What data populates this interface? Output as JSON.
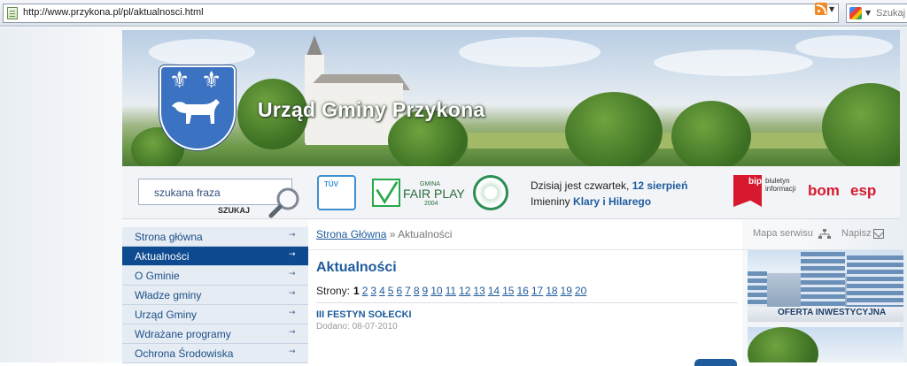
{
  "browser": {
    "url": "http://www.przykona.pl/pl/aktualnosci.html",
    "search_engine_label": "Szukaj"
  },
  "header": {
    "site_title": "Urząd Gminy Przykona"
  },
  "search": {
    "placeholder": "szukana fraza",
    "button_label": "SZUKAJ"
  },
  "partners": {
    "fairplay_small": "GMINA",
    "fairplay_main": "FAIR PLAY",
    "fairplay_year": "2004",
    "tuv_label": "TÜV",
    "bip_label": "bip",
    "bip_sub": "biuletyn informacji",
    "bom_label": "bom",
    "esp_label": "esp"
  },
  "info": {
    "date_prefix": "Dzisiaj jest czwartek,",
    "date_value": "12 sierpień",
    "names_prefix": "Imieniny",
    "names_value": "Klary i Hilarego"
  },
  "nav": {
    "items": [
      {
        "label": "Strona główna",
        "active": false
      },
      {
        "label": "Aktualności",
        "active": true
      },
      {
        "label": "O Gminie",
        "active": false
      },
      {
        "label": "Władze gminy",
        "active": false
      },
      {
        "label": "Urząd Gminy",
        "active": false
      },
      {
        "label": "Wdrażane programy",
        "active": false
      },
      {
        "label": "Ochrona Środowiska",
        "active": false
      }
    ],
    "arrow": "→"
  },
  "breadcrumb": {
    "home": "Strona Główna",
    "separator": "»",
    "current": "Aktualności"
  },
  "utility": {
    "sitemap": "Mapa serwisu",
    "write": "Napisz"
  },
  "main": {
    "heading": "Aktualności",
    "pages_label": "Strony:",
    "pages": [
      "1",
      "2",
      "3",
      "4",
      "5",
      "6",
      "7",
      "8",
      "9",
      "10",
      "11",
      "12",
      "13",
      "14",
      "15",
      "16",
      "17",
      "18",
      "19",
      "20"
    ],
    "current_page": "1",
    "news": [
      {
        "title": "III FESTYN SOŁECKI",
        "date": "Dodano: 08-07-2010"
      }
    ]
  },
  "promo": {
    "label": "OFERTA INWESTYCYJNA"
  },
  "colors": {
    "brand_blue": "#1e5b9c",
    "nav_active": "#0d4a8f",
    "accent_red": "#d7192f"
  }
}
